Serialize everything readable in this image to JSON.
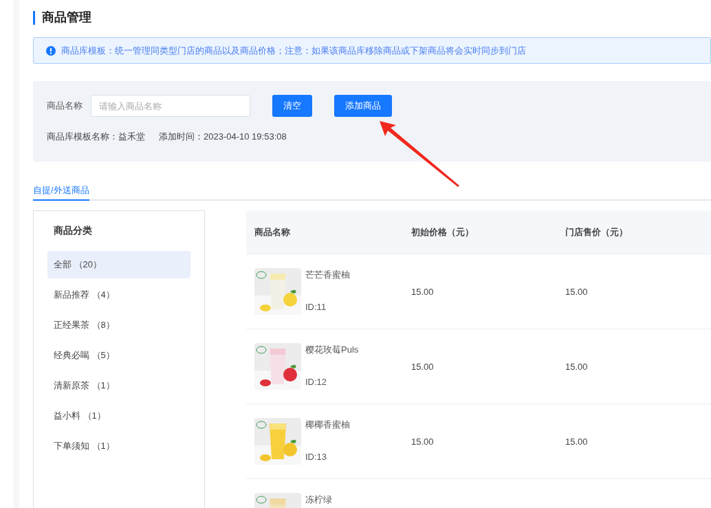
{
  "page_title": "商品管理",
  "notice": "商品库模板：统一管理同类型门店的商品以及商品价格；注意：如果该商品库移除商品或下架商品将会实时同步到门店",
  "filter": {
    "label": "商品名称",
    "placeholder": "请输入商品名称",
    "buttons": [
      "清空",
      "添加商品"
    ],
    "template_label": "商品库模板名称：",
    "template_name": "益禾堂",
    "time_label": "添加时间：",
    "time_value": "2023-04-10 19:53:08"
  },
  "tabs": [
    {
      "label": "自提/外送商品",
      "selected": true
    }
  ],
  "categories": {
    "title": "商品分类",
    "items": [
      {
        "label": "全部 （20）",
        "selected": true
      },
      {
        "label": "新品推荐 （4）",
        "selected": false
      },
      {
        "label": "正经果茶 （8）",
        "selected": false
      },
      {
        "label": "经典必喝 （5）",
        "selected": false
      },
      {
        "label": "清新原茶 （1）",
        "selected": false
      },
      {
        "label": "益小料 （1）",
        "selected": false
      },
      {
        "label": "下单须知 （1）",
        "selected": false
      }
    ]
  },
  "table": {
    "columns": [
      "商品名称",
      "初始价格（元）",
      "门店售价（元）"
    ],
    "rows": [
      {
        "name": "芒芒香蜜柚",
        "id": "ID:11",
        "price": "15.00",
        "store_price": "15.00"
      },
      {
        "name": "樱花玫莓Puls",
        "id": "ID:12",
        "price": "15.00",
        "store_price": "15.00"
      },
      {
        "name": "椰椰香蜜柚",
        "id": "ID:13",
        "price": "15.00",
        "store_price": "15.00"
      },
      {
        "name": "冻柠绿"
      }
    ]
  }
}
